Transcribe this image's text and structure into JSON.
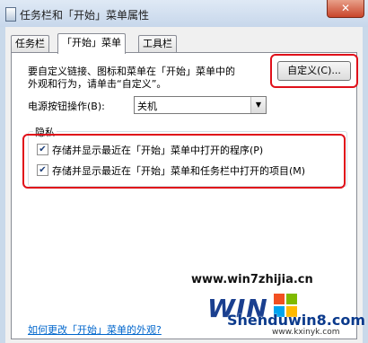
{
  "window": {
    "title": "任务栏和「开始」菜单属性",
    "close_glyph": "✕"
  },
  "tabs": [
    {
      "label": "任务栏"
    },
    {
      "label": "「开始」菜单"
    },
    {
      "label": "工具栏"
    }
  ],
  "start_menu": {
    "description_line1": "要自定义链接、图标和菜单在「开始」菜单中的",
    "description_line2": "外观和行为，请单击“自定义”。",
    "customize_button": "自定义(C)...",
    "power_label": "电源按钮操作(B):",
    "power_value": "关机"
  },
  "privacy": {
    "title": "隐私",
    "items": [
      {
        "label": "存储并显示最近在「开始」菜单中打开的程序(P)",
        "checked": true
      },
      {
        "label": "存储并显示最近在「开始」菜单和任务栏中打开的项目(M)",
        "checked": true
      }
    ]
  },
  "help_link": "如何更改「开始」菜单的外观?",
  "watermarks": {
    "site1": "www.win7zhijia.cn",
    "site2": "Shenduwin8.com",
    "site3": "www.kxinyk.com"
  },
  "colors": {
    "highlight": "#e0101a",
    "link": "#0066cc"
  }
}
